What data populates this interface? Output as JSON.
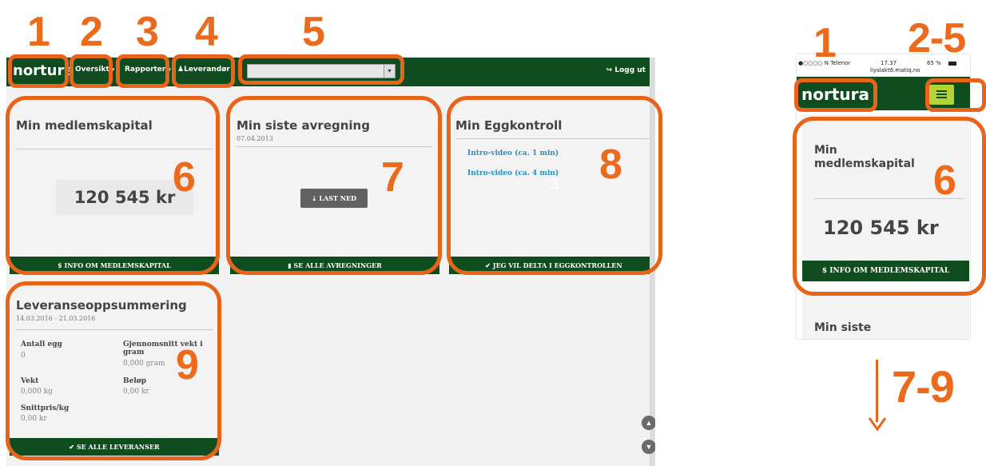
{
  "annotations": {
    "desktop_numbers": [
      "1",
      "2",
      "3",
      "4",
      "5",
      "6",
      "7",
      "8",
      "9"
    ],
    "mobile_numbers": [
      "1",
      "2-5",
      "6",
      "7-9"
    ]
  },
  "colors": {
    "brand_green": "#0f4d1f",
    "accent_orange": "#ec6a1c",
    "link_blue": "#2a8fc2",
    "hamburger": "#b4d334"
  },
  "desktop": {
    "nav": {
      "logo": "nortura",
      "oversikt": "Oversikt",
      "rapporter": "Rapporter",
      "leverandor": "Leverandør",
      "logout": "Logg ut",
      "logout_icon": "logout-icon"
    },
    "cards": {
      "medlemskapital": {
        "title": "Min medlemskapital",
        "amount": "120 545 kr",
        "footer": "INFO OM MEDLEMSKAPITAL",
        "footer_icon": "dollar-icon"
      },
      "avregning": {
        "title": "Min siste avregning",
        "date": "07.04.2013",
        "download": "LAST NED",
        "footer": "SE ALLE AVREGNINGER",
        "footer_icon": "file-icon"
      },
      "eggkontroll": {
        "title": "Min Eggkontroll",
        "links": [
          "Intro-video (ca. 1 min)",
          "Intro-video (ca. 4 min)"
        ],
        "watermark": "3",
        "footer": "JEG VIL DELTA I EGGKONTROLLEN",
        "footer_icon": "check-icon"
      },
      "leveranse": {
        "title": "Leveranseoppsummering",
        "period": "14.03.2016 - 21.03.2016",
        "fields": [
          {
            "label": "Antall egg",
            "value": "0"
          },
          {
            "label": "Gjennomsnitt vekt i gram",
            "value": "0,000 gram"
          },
          {
            "label": "Vekt",
            "value": "0,000 kg"
          },
          {
            "label": "Beløp",
            "value": "0,00 kr"
          },
          {
            "label": "Snittpris/kg",
            "value": "0,00 kr"
          }
        ],
        "footer": "SE ALLE LEVERANSER",
        "footer_icon": "check-icon"
      }
    }
  },
  "mobile": {
    "status": {
      "carrier": "●○○○○ N Telenor",
      "time": "17.37",
      "battery": "65 %",
      "url": "liyslakt6.matiq.no"
    },
    "logo": "nortura",
    "card_title": "Min medlemskapital",
    "amount": "120 545 kr",
    "footer": "INFO OM MEDLEMSKAPITAL",
    "next_card_title": "Min siste"
  }
}
